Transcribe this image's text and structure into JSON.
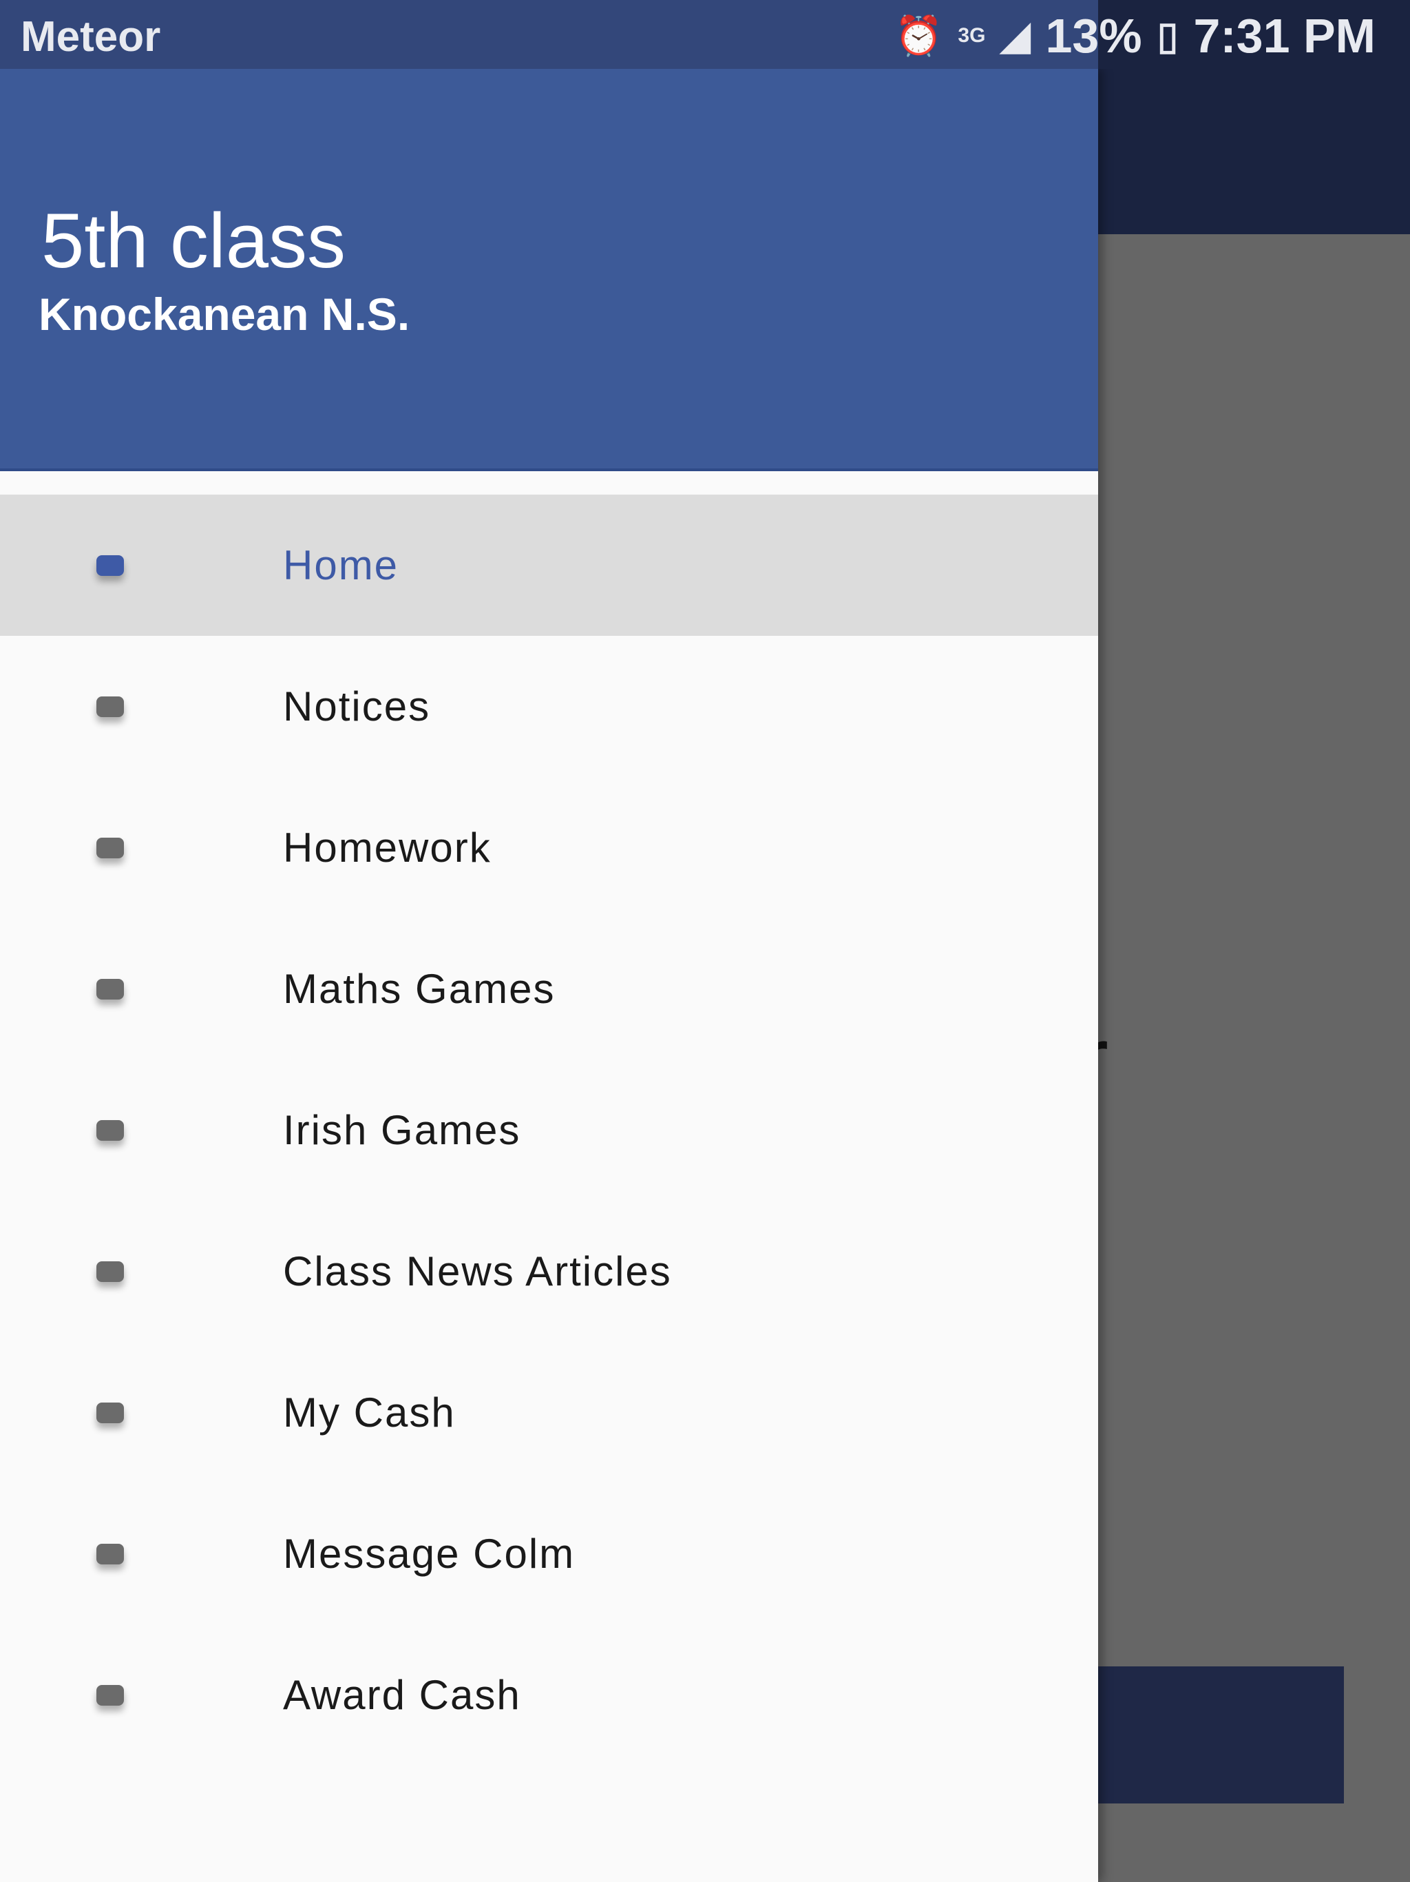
{
  "status_bar": {
    "carrier": "Meteor",
    "battery": "13%",
    "time": "7:31 PM",
    "icons": [
      "alarm-icon",
      "3g-icon",
      "signal-icon",
      "battery-charging-icon"
    ]
  },
  "background": {
    "partial_text": "er"
  },
  "drawer": {
    "title": "5th class",
    "subtitle": "Knockanean N.S.",
    "active_index": 0,
    "items": [
      {
        "label": "Home",
        "icon": "bullet-icon"
      },
      {
        "label": "Notices",
        "icon": "bullet-icon"
      },
      {
        "label": "Homework",
        "icon": "bullet-icon"
      },
      {
        "label": "Maths Games",
        "icon": "bullet-icon"
      },
      {
        "label": "Irish Games",
        "icon": "bullet-icon"
      },
      {
        "label": "Class News Articles",
        "icon": "bullet-icon"
      },
      {
        "label": "My Cash",
        "icon": "bullet-icon"
      },
      {
        "label": "Message Colm",
        "icon": "bullet-icon"
      },
      {
        "label": "Award Cash",
        "icon": "bullet-icon"
      }
    ]
  },
  "colors": {
    "header": "#3d5a98",
    "accent": "#3e5aa6",
    "appbar": "#1a2340",
    "scrim": "#666666"
  }
}
